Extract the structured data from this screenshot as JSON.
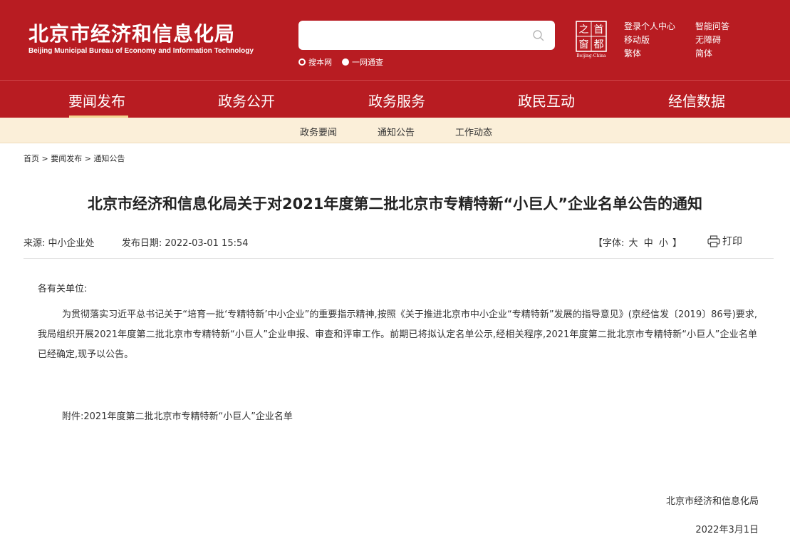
{
  "header": {
    "brand_cn": "北京市经济和信息化局",
    "brand_en": "Beijing Municipal Bureau of Economy and Information Technology",
    "search": {
      "placeholder": "",
      "value": ""
    },
    "scope_options": [
      "搜本网",
      "一网通查"
    ],
    "logo": {
      "chars": [
        "之",
        "首",
        "窗",
        "都"
      ],
      "caption": "Beijing-China"
    },
    "links": [
      "登录个人中心",
      "智能问答",
      "移动版",
      "无障碍",
      "繁体",
      "简体"
    ],
    "colors": {
      "primary": "#b81c22",
      "subnav_bg": "#fbefd9",
      "active_bar": "#f3d48f"
    }
  },
  "main_nav": [
    "要闻发布",
    "政务公开",
    "政务服务",
    "政民互动",
    "经信数据"
  ],
  "sub_nav": [
    "政务要闻",
    "通知公告",
    "工作动态"
  ],
  "breadcrumb": "首页 > 要闻发布 > 通知公告",
  "article": {
    "title": "北京市经济和信息化局关于对2021年度第二批北京市专精特新“小巨人”企业名单公告的通知",
    "source_label": "来源:",
    "source": "中小企业处",
    "date_label": "发布日期:",
    "date": "2022-03-01 15:54",
    "font_prefix": "【字体:",
    "font_sizes": [
      "大",
      "中",
      "小"
    ],
    "font_suffix": "】",
    "print_label": "打印",
    "salutation": "各有关单位:",
    "paragraph": "为贯彻落实习近平总书记关于“培育一批‘专精特新’中小企业”的重要指示精神,按照《关于推进北京市中小企业“专精特新”发展的指导意见》(京经信发〔2019〕86号)要求,我局组织开展2021年度第二批北京市专精特新“小巨人”企业申报、审查和评审工作。前期已将拟认定名单公示,经相关程序,2021年度第二批北京市专精特新“小巨人”企业名单已经确定,现予以公告。",
    "attachment": "附件:2021年度第二批北京市专精特新“小巨人”企业名单",
    "signer": "北京市经济和信息化局",
    "sign_date": "2022年3月1日"
  }
}
